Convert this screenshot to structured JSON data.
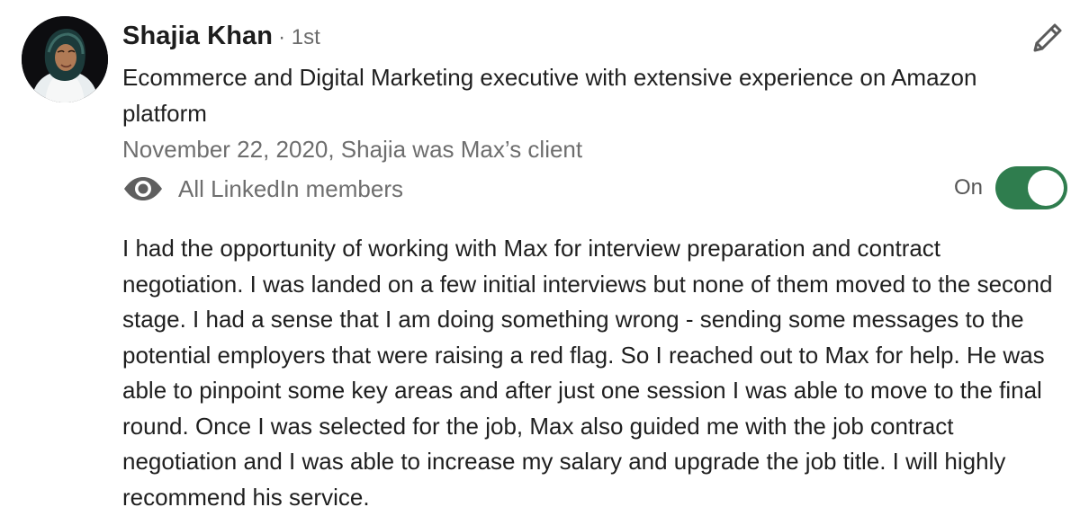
{
  "recommender": {
    "name": "Shajia Khan",
    "degree": "· 1st",
    "headline": "Ecommerce and Digital Marketing executive with extensive experience on Amazon platform",
    "meta": "November 22, 2020, Shajia was Max’s client"
  },
  "visibility": {
    "icon": "eye-icon",
    "label": "All LinkedIn members",
    "toggle_label": "On",
    "toggle_on": true,
    "toggle_color": "#2f7d4e"
  },
  "actions": {
    "edit_icon": "pencil-icon"
  },
  "recommendation": {
    "text": "I had the opportunity of working with Max for interview preparation and contract negotiation. I was landed on a few initial interviews but none of them moved to the second stage. I had a sense that I am doing something wrong - sending some messages to the potential employers that were raising a red flag. So I reached out to Max for help. He was able to pinpoint some key areas and after just one session I was able to move to the final round. Once I was selected for the job, Max also guided me with the job contract negotiation and I was able to increase my salary and upgrade the job title. I will highly recommend his service."
  }
}
